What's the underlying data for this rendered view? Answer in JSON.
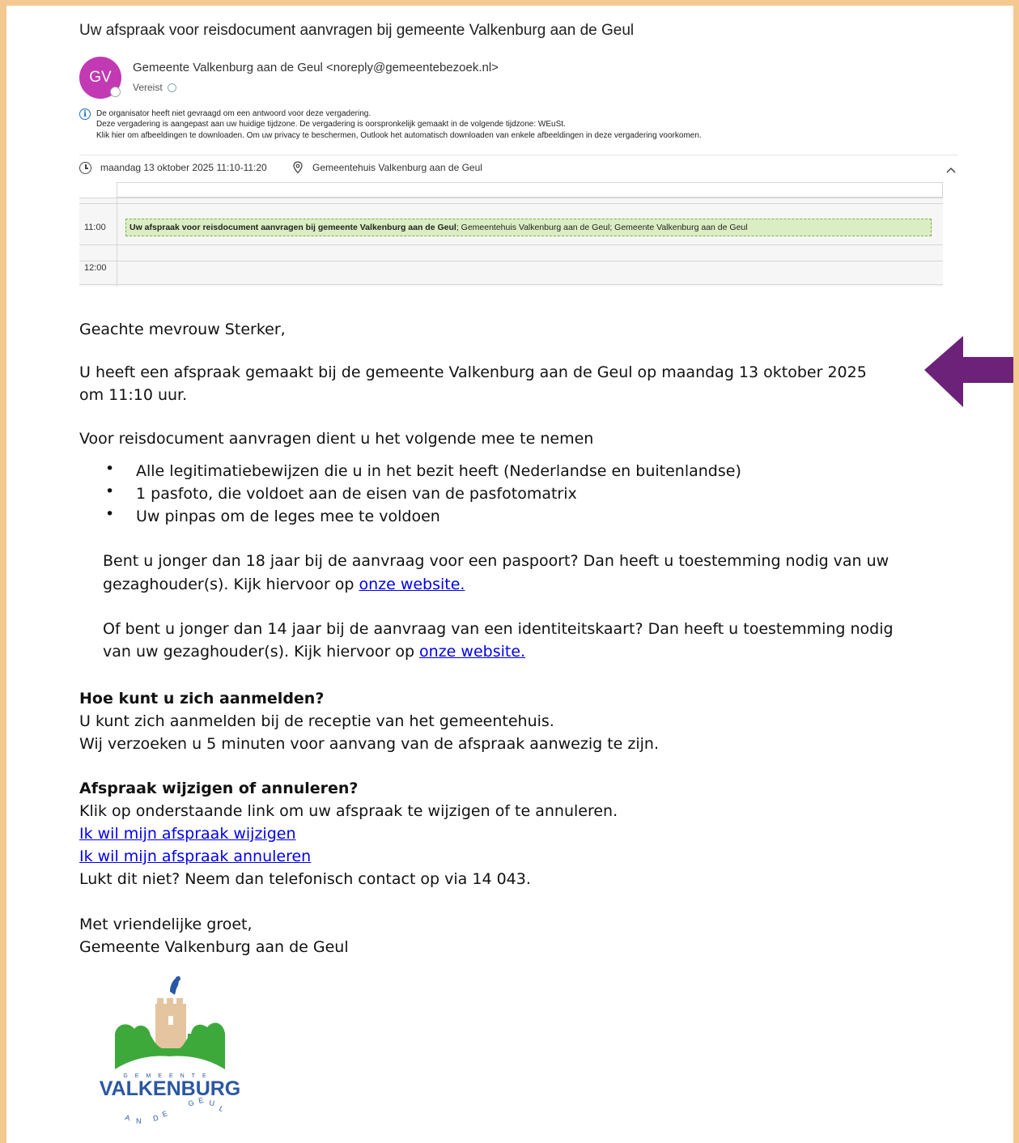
{
  "header": {
    "subject": "Uw afspraak voor reisdocument aanvragen bij gemeente Valkenburg aan de Geul",
    "avatar_initials": "GV",
    "avatar_color": "#c239b3",
    "sender": "Gemeente Valkenburg aan de Geul <noreply@gemeentebezoek.nl>",
    "required_label": "Vereist",
    "info_lines": [
      "De organisator heeft niet gevraagd om een antwoord voor deze vergadering.",
      "Deze vergadering is aangepast aan uw huidige tijdzone. De vergadering is oorspronkelijk gemaakt in de volgende tijdzone: WEuSt.",
      "Klik hier om afbeeldingen te downloaden. Om uw privacy te beschermen, Outlook het automatisch downloaden van enkele afbeeldingen in deze vergadering voorkomen."
    ],
    "when": "maandag 13 oktober 2025 11:10-11:20",
    "where": "Gemeentehuis Valkenburg aan de Geul"
  },
  "calendar": {
    "time_1100": "11:00",
    "time_1200": "12:00",
    "event_title": "Uw afspraak voor reisdocument aanvragen bij gemeente Valkenburg aan de Geul",
    "event_details": "; Gemeentehuis Valkenburg aan de Geul; Gemeente Valkenburg aan de Geul",
    "event_color": "#dbeec3"
  },
  "body": {
    "greeting": "Geachte mevrouw Sterker,",
    "appointment_line1": "U heeft een afspraak gemaakt bij de gemeente Valkenburg aan de Geul op maandag 13 oktober 2025",
    "appointment_line2": "om 11:10 uur.",
    "bring_intro": "Voor reisdocument aanvragen dient u het volgende mee te nemen",
    "bring_items": [
      "Alle legitimatiebewijzen die u in het bezit heeft (Nederlandse en buitenlandse)",
      "1 pasfoto, die voldoet aan de eisen van de pasfotomatrix",
      "Uw pinpas om de leges mee te voldoen"
    ],
    "under18_line1": "Bent u jonger dan 18 jaar bij de aanvraag voor een paspoort? Dan heeft u toestemming nodig van uw",
    "under18_line2": "gezaghouder(s). Kijk hiervoor op ",
    "under14_line1": "Of bent u jonger dan 14 jaar bij de aanvraag van een identiteitskaart? Dan heeft u toestemming nodig",
    "under14_line2": "van uw gezaghouder(s). Kijk hiervoor op ",
    "website_link": "onze website.",
    "signin_heading": "Hoe kunt u zich aanmelden?",
    "signin_line1": "U kunt zich aanmelden bij de receptie van het gemeentehuis.",
    "signin_line2": "Wij verzoeken u 5 minuten voor aanvang van de afspraak aanwezig te zijn.",
    "change_heading": "Afspraak wijzigen of annuleren?",
    "change_line": "Klik op onderstaande link om uw afspraak te wijzigen of te annuleren.",
    "change_link": "Ik wil mijn afspraak wijzigen",
    "cancel_link": "Ik wil mijn afspraak annuleren",
    "phone_line": "Lukt dit niet? Neem dan telefonisch contact op via 14 043.",
    "closing": "Met vriendelijke groet,",
    "signature": "Gemeente Valkenburg aan de Geul"
  },
  "logo": {
    "top_text": "GEMEENTE",
    "main_text": "VALKENBURG",
    "bottom_text": "AAN DE GEUL"
  },
  "annotation": {
    "arrow_color": "#6b2278"
  },
  "colors": {
    "frame": "#f3c991",
    "link": "#0000ee",
    "info": "#1a6fbf"
  }
}
